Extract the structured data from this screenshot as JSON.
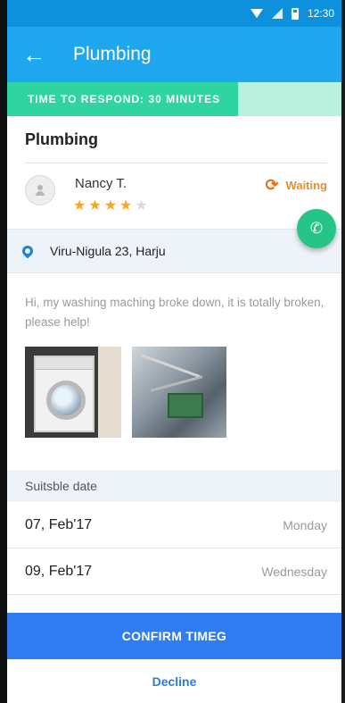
{
  "status_bar": {
    "time": "12:30",
    "icons": [
      "wifi-icon",
      "signal-icon",
      "battery-icon"
    ]
  },
  "app_bar": {
    "back_icon": "arrow-left-icon",
    "title": "Plumbing"
  },
  "respond_banner": {
    "label": "TIME TO RESPOND: 30 MINUTES",
    "progress": 0.69
  },
  "job": {
    "title": "Plumbing",
    "customer": {
      "name": "Nancy T.",
      "rating": 4,
      "rating_max": 5
    },
    "status": {
      "icon": "refresh-icon",
      "label": "Waiting",
      "color": "#e6912a"
    },
    "call_icon": "phone-icon",
    "address": {
      "icon": "location-pin-icon",
      "text": "Viru-Nigula 23, Harju"
    },
    "message": "Hi, my washing maching broke down, it is totally broken, please help!"
  },
  "dates": {
    "header": "Suitsble date",
    "rows": [
      {
        "date": "07, Feb'17",
        "day": "Monday"
      },
      {
        "date": "09, Feb'17",
        "day": "Wednesday"
      }
    ]
  },
  "actions": {
    "confirm_label": "CONFIRM TIMEG",
    "decline_label": "Decline"
  },
  "colors": {
    "primary": "#1ea7ee",
    "status_bar": "#0d91dd",
    "respond": "#2fd4a0",
    "call": "#25c585",
    "confirm": "#2f7df0",
    "star": "#f6a623"
  }
}
